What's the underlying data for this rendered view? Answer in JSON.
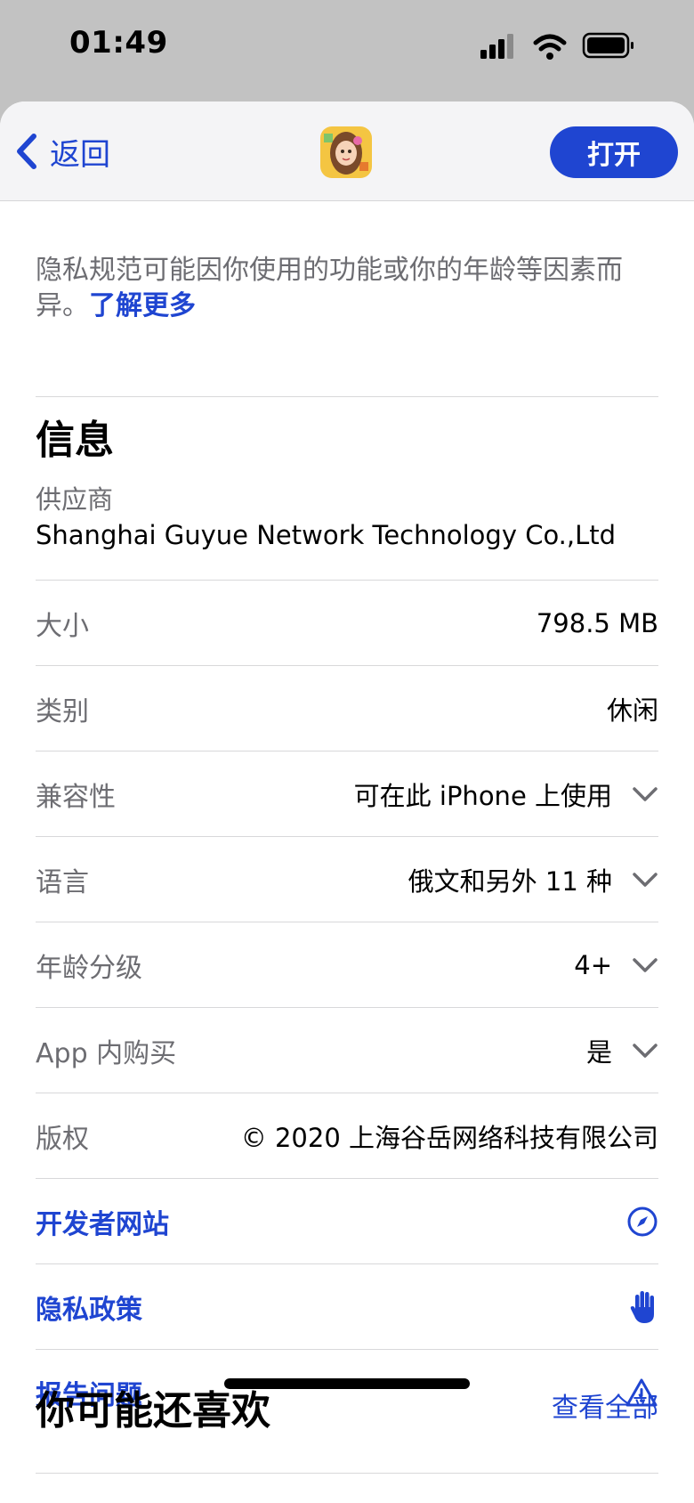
{
  "status_bar": {
    "time": "01:49"
  },
  "nav": {
    "back_label": "返回",
    "open_label": "打开"
  },
  "privacy": {
    "note": "隐私规范可能因你使用的功能或你的年龄等因素而异。",
    "learn_more": "了解更多"
  },
  "info": {
    "title": "信息",
    "vendor_label": "供应商",
    "vendor_name": "Shanghai Guyue Network Technology Co.,Ltd",
    "rows": [
      {
        "label": "大小",
        "value": "798.5 MB"
      },
      {
        "label": "类别",
        "value": "休闲"
      },
      {
        "label": "兼容性",
        "value": "可在此 iPhone 上使用"
      },
      {
        "label": "语言",
        "value": "俄文和另外 11 种"
      },
      {
        "label": "年龄分级",
        "value": "4+"
      },
      {
        "label": "App 内购买",
        "value": "是"
      },
      {
        "label": "版权",
        "value": "© 2020 上海谷岳网络科技有限公司"
      }
    ],
    "links": [
      {
        "label": "开发者网站",
        "icon": "compass-icon"
      },
      {
        "label": "隐私政策",
        "icon": "hand-icon"
      },
      {
        "label": "报告问题",
        "icon": "warning-icon"
      }
    ]
  },
  "next_section": {
    "title": "你可能还喜欢",
    "see_all": "查看全部"
  },
  "colors": {
    "accent": "#1f45d1",
    "secondary_text": "#6d6d72",
    "status_bar_bg": "#c2c2c2"
  }
}
